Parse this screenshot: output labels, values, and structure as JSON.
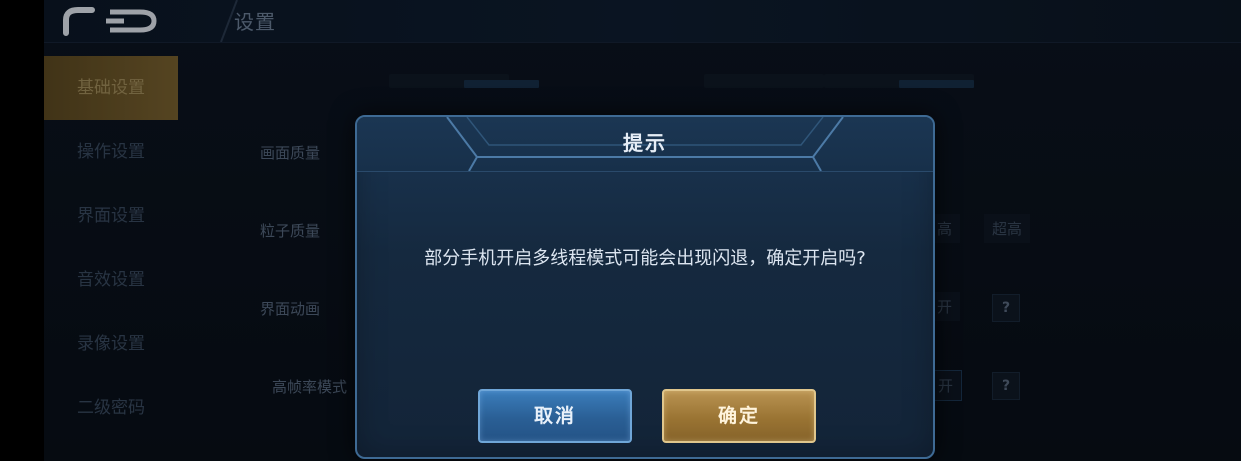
{
  "header": {
    "title": "设置"
  },
  "sidebar": {
    "items": [
      {
        "label": "基础设置",
        "active": true
      },
      {
        "label": "操作设置"
      },
      {
        "label": "界面设置"
      },
      {
        "label": "音效设置"
      },
      {
        "label": "录像设置"
      },
      {
        "label": "二级密码"
      }
    ]
  },
  "settings": {
    "rows": [
      {
        "label": "画面质量"
      },
      {
        "label": "粒子质量",
        "option_partial": "高",
        "option_full": "超高"
      },
      {
        "label": "界面动画",
        "toggle_partial": "开",
        "help": "?"
      },
      {
        "label": "高帧率模式",
        "toggle_partial": "开",
        "help": "?"
      }
    ]
  },
  "dialog": {
    "title": "提示",
    "message": "部分手机开启多线程模式可能会出现闪退，确定开启吗?",
    "cancel_label": "取消",
    "confirm_label": "确定"
  },
  "colors": {
    "confirm_gold": "#9a7433",
    "cancel_blue": "#2a5f95",
    "dialog_border": "#3e6a94"
  }
}
